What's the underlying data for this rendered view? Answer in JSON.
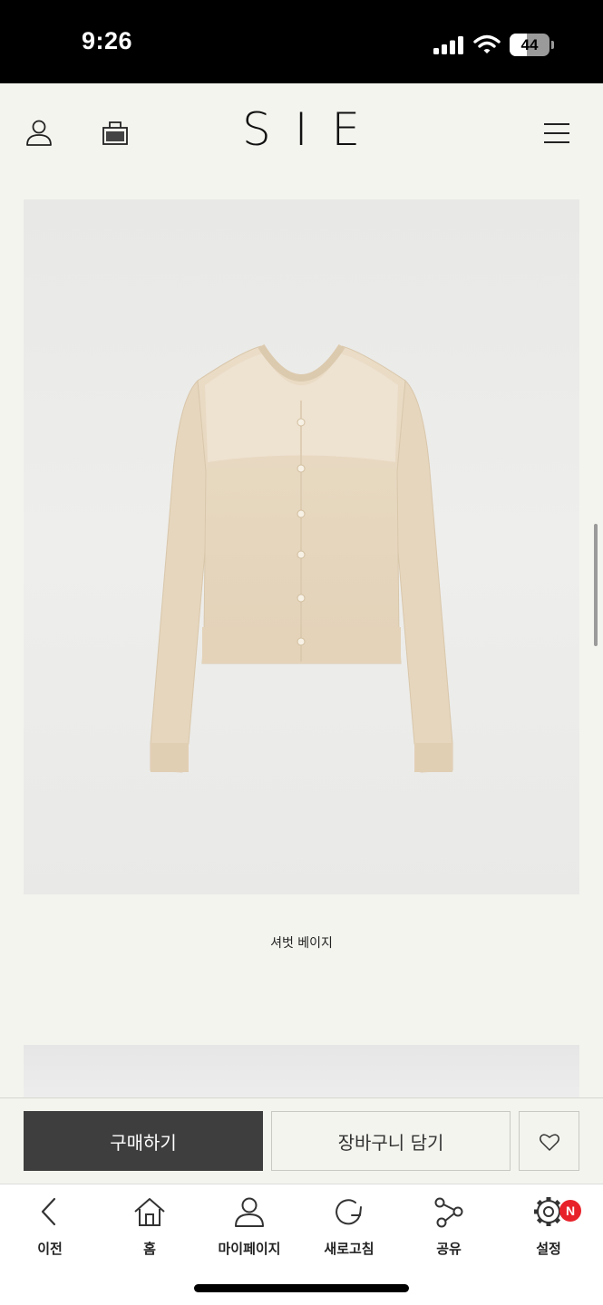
{
  "status_bar": {
    "time": "9:26",
    "battery_level": "44",
    "battery_fill_fraction": 0.44,
    "icons": [
      "signal-icon",
      "wifi-icon",
      "battery-icon"
    ]
  },
  "header": {
    "logo": "SIE",
    "icons": [
      "user-icon",
      "shopping-bag-icon",
      "hamburger-menu-icon"
    ]
  },
  "product": {
    "color_name": "셔벗 베이지"
  },
  "actions": {
    "buy_label": "구매하기",
    "cart_label": "장바구니 담기",
    "wishlist_icon": "heart-icon"
  },
  "bottom_nav": {
    "items": [
      {
        "label": "이전",
        "icon": "chevron-left-icon"
      },
      {
        "label": "홈",
        "icon": "home-icon"
      },
      {
        "label": "마이페이지",
        "icon": "user-icon"
      },
      {
        "label": "새로고침",
        "icon": "refresh-icon"
      },
      {
        "label": "공유",
        "icon": "share-icon"
      },
      {
        "label": "설정",
        "icon": "gear-icon"
      }
    ],
    "settings_badge": "N"
  },
  "colors": {
    "background": "#f4f4ef",
    "buy_button": "#3e3e3e",
    "badge": "#e8222a",
    "cardigan": "#e8d8c0"
  }
}
